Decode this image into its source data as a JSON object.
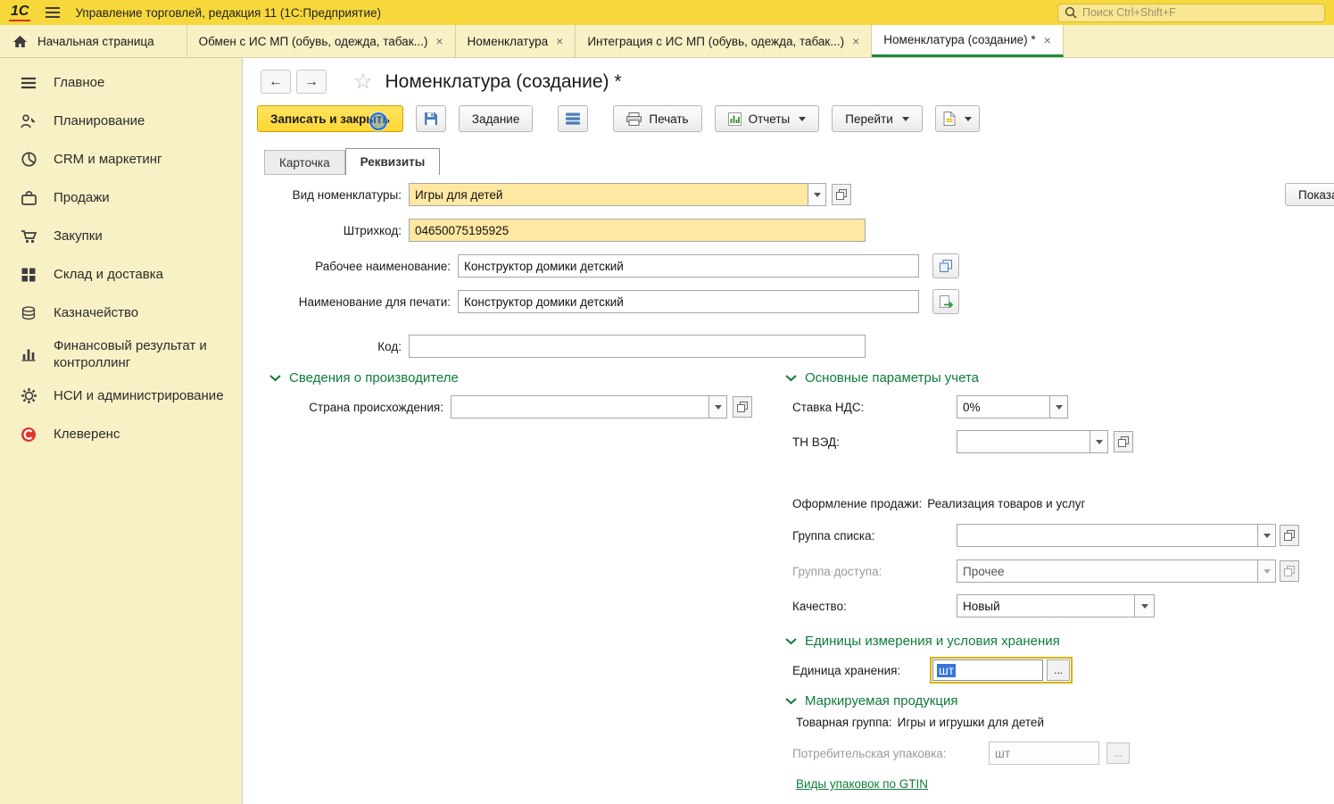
{
  "icons": {
    "logo": "1С",
    "back": "←",
    "forward": "→",
    "favorite": "☆",
    "close": "×",
    "ellipsis": "..."
  },
  "titlebar": {
    "title": "Управление торговлей, редакция 11 (1С:Предприятие)",
    "search_placeholder": "Поиск Ctrl+Shift+F"
  },
  "window_tabs": {
    "home_label": "Начальная страница",
    "tabs": [
      {
        "label": "Обмен с ИС МП (обувь, одежда, табак...)"
      },
      {
        "label": "Номенклатура"
      },
      {
        "label": "Интеграция с ИС МП (обувь, одежда, табак...)"
      },
      {
        "label": "Номенклатура (создание) *"
      }
    ]
  },
  "sidebar": {
    "items": [
      {
        "label": "Главное"
      },
      {
        "label": "Планирование"
      },
      {
        "label": "CRM и маркетинг"
      },
      {
        "label": "Продажи"
      },
      {
        "label": "Закупки"
      },
      {
        "label": "Склад и доставка"
      },
      {
        "label": "Казначейство"
      },
      {
        "label": "Финансовый результат и контроллинг"
      },
      {
        "label": "НСИ и администрирование"
      },
      {
        "label": "Клеверенс"
      }
    ]
  },
  "page": {
    "title": "Номенклатура (создание) *",
    "toolbar": {
      "save_close": "Записать и закрыть",
      "task": "Задание",
      "print": "Печать",
      "reports": "Отчеты",
      "goto": "Перейти"
    },
    "form_tabs": [
      {
        "label": "Карточка"
      },
      {
        "label": "Реквизиты"
      }
    ],
    "show_button": "Показать",
    "fields": {
      "kind_label": "Вид номенклатуры:",
      "kind_value": "Игры для детей",
      "barcode_label": "Штрихкод:",
      "barcode_value": "04650075195925",
      "work_name_label": "Рабочее наименование:",
      "work_name_value": "Конструктор домики детский",
      "print_name_label": "Наименование для печати:",
      "print_name_value": "Конструктор домики детский",
      "code_label": "Код:",
      "code_value": ""
    },
    "producer_section": {
      "title": "Сведения о производителе",
      "country_label": "Страна происхождения:",
      "country_value": ""
    },
    "params_section": {
      "title": "Основные параметры учета",
      "vat_label": "Ставка НДС:",
      "vat_value": "0%",
      "tnved_label": "ТН ВЭД:",
      "tnved_value": "",
      "sale_label": "Оформление продажи:",
      "sale_value": "Реализация товаров и услуг",
      "list_group_label": "Группа списка:",
      "list_group_value": "",
      "access_group_label": "Группа доступа:",
      "access_group_value": "Прочее",
      "quality_label": "Качество:",
      "quality_value": "Новый"
    },
    "units_section": {
      "title": "Единицы измерения и условия хранения",
      "storage_unit_label": "Единица хранения:",
      "storage_unit_value": "шт"
    },
    "marking_section": {
      "title": "Маркируемая продукция",
      "product_group_label": "Товарная группа:",
      "product_group_value": "Игры и игрушки для детей",
      "consumer_pack_label": "Потребительская упаковка:",
      "consumer_pack_value": "шт",
      "gtin_link": "Виды упаковок по GTIN"
    }
  }
}
